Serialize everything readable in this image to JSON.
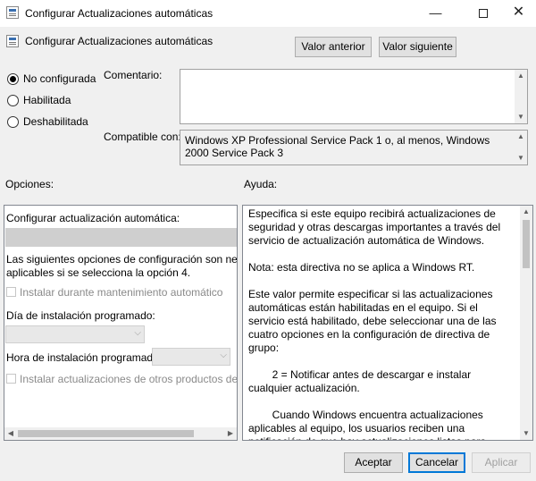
{
  "window": {
    "title": "Configurar Actualizaciones automáticas",
    "minimize_glyph": "—",
    "close_glyph": "✕"
  },
  "header": {
    "title": "Configurar Actualizaciones automáticas",
    "prev_button": "Valor anterior",
    "next_button": "Valor siguiente"
  },
  "state_options": [
    {
      "label": "No configurada",
      "checked": true
    },
    {
      "label": "Habilitada",
      "checked": false
    },
    {
      "label": "Deshabilitada",
      "checked": false
    }
  ],
  "comment": {
    "label": "Comentario:",
    "value": ""
  },
  "compatible": {
    "label": "Compatible con:",
    "value": "Windows XP Professional Service Pack 1 o, al menos, Windows 2000 Service Pack 3"
  },
  "options": {
    "label": "Opciones:",
    "configure_label": "Configurar actualización automática:",
    "desc_line1": "Las siguientes opciones de configuración son necesarias",
    "desc_line2": "aplicables si se selecciona la opción 4.",
    "install_maintenance": "Instalar durante mantenimiento automático",
    "install_day_label": "Día de instalación programado:",
    "install_time_label": "Hora de instalación programada:",
    "install_other": "Instalar actualizaciones de otros productos de Micros"
  },
  "help": {
    "label": "Ayuda:",
    "paragraphs": [
      "Especifica si este equipo recibirá actualizaciones de seguridad y otras descargas importantes a través del servicio de actualización automática de Windows.",
      "Nota: esta directiva no se aplica a Windows RT.",
      "Este valor permite especificar si las actualizaciones automáticas están habilitadas en el equipo. Si el servicio está habilitado, debe seleccionar una de las cuatro opciones en la configuración de directiva de grupo:",
      "        2 = Notificar antes de descargar e instalar cualquier actualización.",
      "        Cuando Windows encuentra actualizaciones aplicables al equipo, los usuarios reciben una notificación de que hay actualizaciones listas para descargarse. Después de ir a Windows Update, los usuarios pueden descargar e instalar cualquier actualización disponible."
    ]
  },
  "footer": {
    "accept": "Aceptar",
    "cancel": "Cancelar",
    "apply": "Aplicar"
  },
  "colors": {
    "accent": "#0078d7"
  }
}
